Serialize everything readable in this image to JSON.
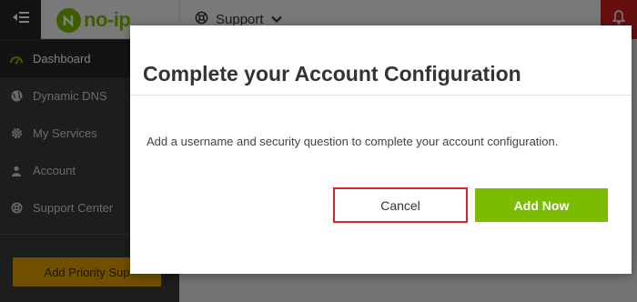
{
  "header": {
    "logo_text": "no-ip",
    "support_label": "Support"
  },
  "sidebar": {
    "items": [
      {
        "label": "Dashboard",
        "icon": "dashboard-icon",
        "active": true
      },
      {
        "label": "Dynamic DNS",
        "icon": "globe-icon",
        "active": false
      },
      {
        "label": "My Services",
        "icon": "gear-icon",
        "active": false
      },
      {
        "label": "Account",
        "icon": "user-icon",
        "active": false
      },
      {
        "label": "Support Center",
        "icon": "lifebuoy-icon",
        "active": false
      }
    ],
    "priority_button": "Add Priority Sup"
  },
  "modal": {
    "title_prefix": "Complete your ",
    "title_bold": "Account Configuration",
    "body": "Add a username and security question to complete your account configuration.",
    "cancel_label": "Cancel",
    "add_label": "Add Now"
  },
  "colors": {
    "brand_green": "#7dbb00",
    "cancel_outline": "#d4262c",
    "notification_red": "#cc1f1f",
    "priority_orange": "#e39e00"
  }
}
